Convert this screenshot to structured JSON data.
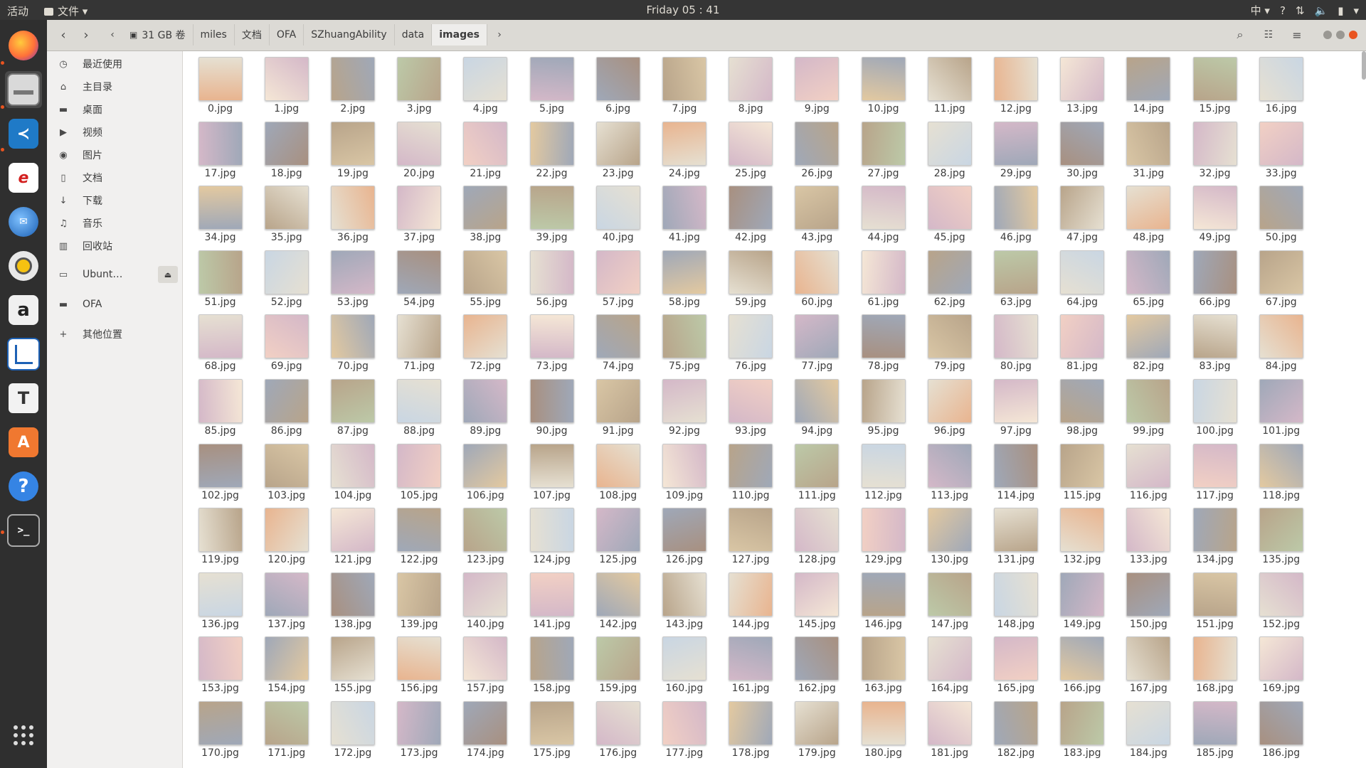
{
  "topbar": {
    "activities": "活动",
    "app_menu": "文件",
    "clock": "Friday 05 : 41",
    "input_method": "中",
    "help": "?"
  },
  "dock": {
    "apps": [
      "firefox-icon",
      "files-icon",
      "vscode-icon",
      "text-editor-icon",
      "thunderbird-icon",
      "rhythmbox-icon",
      "amazon-icon",
      "libreoffice-writer-icon",
      "typora-icon",
      "software-center-icon",
      "help-icon",
      "terminal-icon"
    ],
    "show_apps": "show-apps-icon"
  },
  "header": {
    "path": [
      "31 GB 卷",
      "miles",
      "文档",
      "OFA",
      "SZhuangAbility",
      "data",
      "images"
    ],
    "current": "images"
  },
  "sidebar": {
    "items": [
      {
        "label": "最近使用",
        "icon": "clock-icon"
      },
      {
        "label": "主目录",
        "icon": "home-icon"
      },
      {
        "label": "桌面",
        "icon": "folder-icon"
      },
      {
        "label": "视频",
        "icon": "video-icon"
      },
      {
        "label": "图片",
        "icon": "camera-icon"
      },
      {
        "label": "文档",
        "icon": "document-icon"
      },
      {
        "label": "下载",
        "icon": "download-icon"
      },
      {
        "label": "音乐",
        "icon": "music-icon"
      },
      {
        "label": "回收站",
        "icon": "trash-icon"
      },
      {
        "label": "Ubunt…",
        "icon": "drive-icon"
      },
      {
        "label": "OFA",
        "icon": "folder-icon"
      },
      {
        "label": "其他位置",
        "icon": "plus-icon"
      }
    ]
  },
  "files": {
    "count": 187,
    "suffix": ".jpg"
  },
  "colors": {
    "accent": "#e95420",
    "panel": "#353535",
    "dock": "#2f2f2f",
    "header": "#dcdad5",
    "sidebar": "#f1f0ef"
  }
}
